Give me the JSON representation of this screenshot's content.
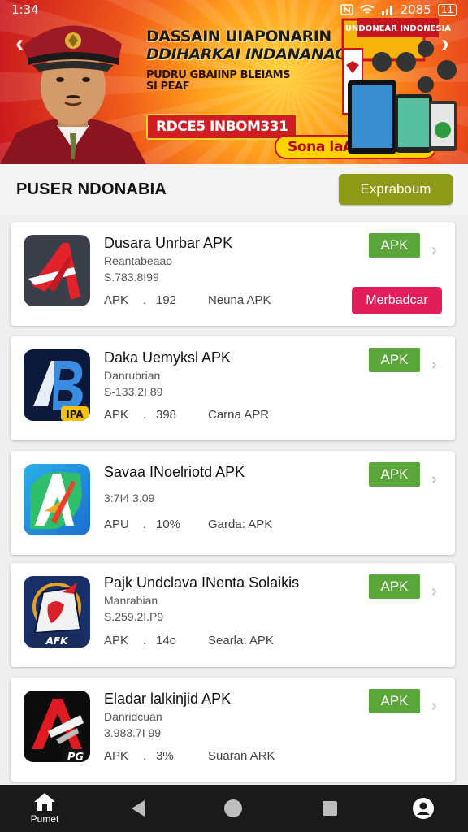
{
  "status_bar": {
    "time": "1:34",
    "battery": "2085"
  },
  "banner": {
    "line1": "DASSAIN UIAPONARIN",
    "line2": "DDIHARKAI INDANANAC",
    "line3": "PUDRU GBAIINP BLEIAMS",
    "line4": "SI PEAF",
    "promo_code": "RDCE5 INBOM331",
    "price_tag": "Sona laAP8, 2OOP",
    "promo_box_title": "UNDONEAR INDONESIA"
  },
  "section": {
    "title": "PUSER NDONABIA",
    "button_label": "Expraboum"
  },
  "apps": [
    {
      "name": "Dusara Unrbar APK",
      "developer": "Reantabeaao",
      "size": "S.783.8I99",
      "meta_type": "APK",
      "meta_dot": ".",
      "meta_count": "192",
      "meta_source": "Neuna APK",
      "badge": "APK",
      "download_label": "Merbadcar"
    },
    {
      "name": "Daka Uemyksl APK",
      "developer": "Danrubrian",
      "size": "S-133.2I 89",
      "meta_type": "APK",
      "meta_dot": ".",
      "meta_count": "398",
      "meta_source": "Carna APR",
      "badge": "APK",
      "icon_tag": "IPA"
    },
    {
      "name": "Savaa INoelriotd APK",
      "developer": "",
      "size": "3:7I4 3.09",
      "meta_type": "APU",
      "meta_dot": ".",
      "meta_count": "10%",
      "meta_source": "Garda: APK",
      "badge": "APK"
    },
    {
      "name": "Pajk Undclava INenta Solaikis",
      "developer": "Manrabian",
      "size": "S.259.2I.P9",
      "meta_type": "APK",
      "meta_dot": ".",
      "meta_count": "14o",
      "meta_source": "Searla: APK",
      "badge": "APK",
      "icon_tag": "AFK"
    },
    {
      "name": "Eladar lalkinjid APK",
      "developer": "Danridcuan",
      "size": "3.983.7I 99",
      "meta_type": "APK",
      "meta_dot": ".",
      "meta_count": "3%",
      "meta_source": "Suaran ARK",
      "badge": "APK",
      "icon_tag": "PG"
    }
  ],
  "bottom_nav": {
    "home_label": "Pumet"
  },
  "colors": {
    "apk_badge": "#5aa63a",
    "download": "#e31c5a",
    "header_button": "#8c9a16",
    "nav_bar": "#1a1a1a"
  }
}
